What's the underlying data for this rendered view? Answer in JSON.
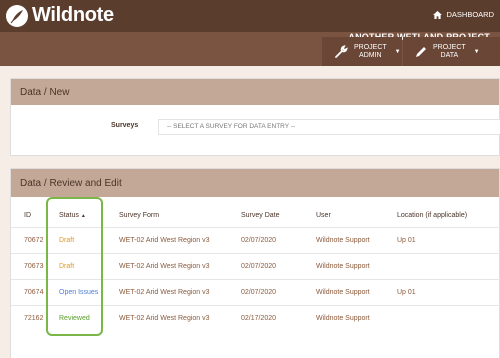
{
  "header": {
    "logo_text": "Wildnote",
    "dashboard_label": "DASHBOARD",
    "project_name": "ANOTHER WETLAND PROJECT",
    "nav": [
      {
        "line1": "PROJECT",
        "line2": "ADMIN",
        "icon": "wrench-icon"
      },
      {
        "line1": "PROJECT",
        "line2": "DATA",
        "icon": "pencil-icon"
      }
    ]
  },
  "new_panel": {
    "title": "Data / New",
    "surveys_label": "Surveys",
    "surveys_select": "-- SELECT A SURVEY FOR DATA ENTRY --"
  },
  "review_panel": {
    "title": "Data / Review and Edit",
    "columns": [
      "ID",
      "Status",
      "Survey Form",
      "Survey Date",
      "User",
      "Location (if applicable)"
    ],
    "sort_indicator": "▲",
    "rows": [
      {
        "id": "70672",
        "status": "Draft",
        "form": "WET-02 Arid West Region v3",
        "date": "02/07/2020",
        "user": "Wildnote Support",
        "location": "Up 01"
      },
      {
        "id": "70673",
        "status": "Draft",
        "form": "WET-02 Arid West Region v3",
        "date": "02/07/2020",
        "user": "Wildnote Support",
        "location": ""
      },
      {
        "id": "70674",
        "status": "Open Issues",
        "form": "WET-02 Arid West Region v3",
        "date": "02/07/2020",
        "user": "Wildnote Support",
        "location": "Up 01"
      },
      {
        "id": "72162",
        "status": "Reviewed",
        "form": "WET-02 Arid West Region v3",
        "date": "02/17/2020",
        "user": "Wildnote Support",
        "location": ""
      }
    ]
  },
  "colors": {
    "topbar": "#5b3d2e",
    "subbar": "#7a5441",
    "panel_header": "#c4a897",
    "draft": "#e09a2a",
    "open_issues": "#4a7fd6",
    "reviewed": "#5aa02c",
    "highlight": "#7ab648"
  }
}
